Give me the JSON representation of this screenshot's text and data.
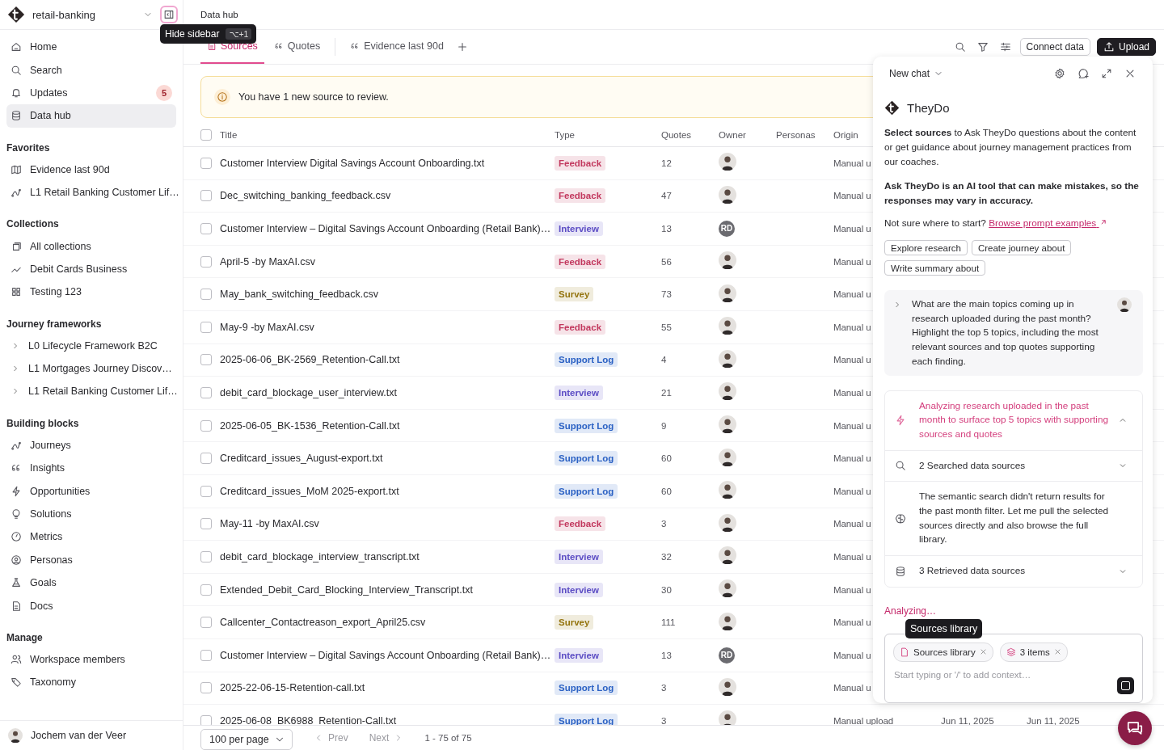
{
  "workspace": {
    "name": "retail-banking",
    "tooltip": {
      "label": "Hide sidebar",
      "shortcut": "⌥+1"
    }
  },
  "nav": [
    {
      "label": "Home",
      "selected": false
    },
    {
      "label": "Search",
      "selected": false
    },
    {
      "label": "Updates",
      "selected": false,
      "badge": "5"
    },
    {
      "label": "Data hub",
      "selected": true
    }
  ],
  "sections": [
    {
      "title": "Favorites",
      "items": [
        {
          "label": "Evidence last 90d"
        },
        {
          "label": "L1 Retail Banking Customer Lif…"
        }
      ]
    },
    {
      "title": "Collections",
      "items": [
        {
          "label": "All collections"
        },
        {
          "label": "Debit Cards Business"
        },
        {
          "label": "Testing 123"
        }
      ]
    },
    {
      "title": "Journey frameworks",
      "items": [
        {
          "label": "L0 Lifecycle Framework B2C",
          "expanded": false
        },
        {
          "label": "L1 Mortgages Journey Discov…",
          "expanded": false
        },
        {
          "label": "L1 Retail Banking Customer Lif…",
          "expanded": false
        }
      ]
    },
    {
      "title": "Building blocks",
      "items": [
        {
          "label": "Journeys"
        },
        {
          "label": "Insights"
        },
        {
          "label": "Opportunities"
        },
        {
          "label": "Solutions"
        },
        {
          "label": "Metrics"
        },
        {
          "label": "Personas"
        },
        {
          "label": "Goals"
        },
        {
          "label": "Docs"
        }
      ]
    },
    {
      "title": "Manage",
      "items": [
        {
          "label": "Workspace members"
        },
        {
          "label": "Taxonomy"
        }
      ]
    }
  ],
  "user": {
    "name": "Jochem van der Veer"
  },
  "breadcrumb": "Data hub",
  "tabs": [
    {
      "label": "Sources",
      "selected": true
    },
    {
      "label": "Quotes",
      "selected": false
    },
    {
      "label": "Evidence last 90d",
      "selected": false
    }
  ],
  "toolbar": {
    "buttons": [
      {
        "label": "Connect data",
        "kind": "secondary"
      },
      {
        "label": "Upload",
        "kind": "primary"
      }
    ]
  },
  "banner": "You have 1 new source to review.",
  "table": {
    "select_all": {
      "checked": false
    },
    "columns": [
      "Title",
      "Type",
      "Quotes",
      "Owner",
      "Personas",
      "Origin"
    ],
    "rows": [
      {
        "checked": false,
        "title": "Customer Interview Digital Savings Account Onboarding.txt",
        "type": {
          "label": "Feedback",
          "color": "#c2385e"
        },
        "quotes": "12",
        "owner": {
          "kind": "avatar"
        },
        "origin": "Manual u"
      },
      {
        "checked": false,
        "title": "Dec_switching_banking_feedback.csv",
        "type": {
          "label": "Feedback",
          "color": "#c2385e"
        },
        "quotes": "47",
        "owner": {
          "kind": "avatar"
        },
        "origin": "Manual u"
      },
      {
        "checked": false,
        "title": "Customer Interview – Digital Savings Account Onboarding (Retail Bank)…",
        "type": {
          "label": "Interview",
          "color": "#5b4cc4"
        },
        "quotes": "13",
        "owner": {
          "kind": "initials",
          "text": "RD"
        },
        "origin": "Manual u"
      },
      {
        "checked": false,
        "title": "April-5 -by MaxAI.csv",
        "type": {
          "label": "Feedback",
          "color": "#c2385e"
        },
        "quotes": "56",
        "owner": {
          "kind": "avatar"
        },
        "origin": "Manual u"
      },
      {
        "checked": false,
        "title": "May_bank_switching_feedback.csv",
        "type": {
          "label": "Survey",
          "color": "#94740f"
        },
        "quotes": "73",
        "owner": {
          "kind": "avatar"
        },
        "origin": "Manual u"
      },
      {
        "checked": false,
        "title": "May-9 -by MaxAI.csv",
        "type": {
          "label": "Feedback",
          "color": "#c2385e"
        },
        "quotes": "55",
        "owner": {
          "kind": "avatar"
        },
        "origin": "Manual u"
      },
      {
        "checked": false,
        "title": "2025-06-06_BK-2569_Retention-Call.txt",
        "type": {
          "label": "Support Log",
          "color": "#2c62c4"
        },
        "quotes": "4",
        "owner": {
          "kind": "avatar"
        },
        "origin": "Manual u"
      },
      {
        "checked": false,
        "title": "debit_card_blockage_user_interview.txt",
        "type": {
          "label": "Interview",
          "color": "#5b4cc4"
        },
        "quotes": "21",
        "owner": {
          "kind": "avatar"
        },
        "origin": "Manual u"
      },
      {
        "checked": false,
        "title": "2025-06-05_BK-1536_Retention-Call.txt",
        "type": {
          "label": "Support Log",
          "color": "#2c62c4"
        },
        "quotes": "9",
        "owner": {
          "kind": "avatar"
        },
        "origin": "Manual u"
      },
      {
        "checked": false,
        "title": "Creditcard_issues_August-export.txt",
        "type": {
          "label": "Support Log",
          "color": "#2c62c4"
        },
        "quotes": "60",
        "owner": {
          "kind": "avatar"
        },
        "origin": "Manual u"
      },
      {
        "checked": false,
        "title": "Creditcard_issues_MoM 2025-export.txt",
        "type": {
          "label": "Support Log",
          "color": "#2c62c4"
        },
        "quotes": "60",
        "owner": {
          "kind": "avatar"
        },
        "origin": "Manual u"
      },
      {
        "checked": false,
        "title": "May-11 -by MaxAI.csv",
        "type": {
          "label": "Feedback",
          "color": "#c2385e"
        },
        "quotes": "3",
        "owner": {
          "kind": "avatar"
        },
        "origin": "Manual u"
      },
      {
        "checked": false,
        "title": "debit_card_blockage_interview_transcript.txt",
        "type": {
          "label": "Interview",
          "color": "#5b4cc4"
        },
        "quotes": "32",
        "owner": {
          "kind": "avatar"
        },
        "origin": "Manual u"
      },
      {
        "checked": false,
        "title": "Extended_Debit_Card_Blocking_Interview_Transcript.txt",
        "type": {
          "label": "Interview",
          "color": "#5b4cc4"
        },
        "quotes": "30",
        "owner": {
          "kind": "avatar"
        },
        "origin": "Manual u"
      },
      {
        "checked": false,
        "title": "Callcenter_Contactreason_export_April25.csv",
        "type": {
          "label": "Survey",
          "color": "#94740f"
        },
        "quotes": "111",
        "owner": {
          "kind": "avatar"
        },
        "origin": "Manual u"
      },
      {
        "checked": false,
        "title": "Customer Interview – Digital Savings Account Onboarding (Retail Bank)…",
        "type": {
          "label": "Interview",
          "color": "#5b4cc4"
        },
        "quotes": "13",
        "owner": {
          "kind": "initials",
          "text": "RD"
        },
        "origin": "Manual u"
      },
      {
        "checked": false,
        "title": "2025-22-06-15-Retention-call.txt",
        "type": {
          "label": "Support Log",
          "color": "#2c62c4"
        },
        "quotes": "3",
        "owner": {
          "kind": "avatar"
        },
        "origin": "Manual u"
      },
      {
        "checked": false,
        "title": "2025-06-08_BK6988_Retention-Call.txt",
        "type": {
          "label": "Support Log",
          "color": "#2c62c4"
        },
        "quotes": "3",
        "owner": {
          "kind": "avatar"
        },
        "origin": "Manual upload",
        "dates": [
          "Jun 11, 2025",
          "Jun 11, 2025"
        ]
      }
    ]
  },
  "pagination": {
    "page_size": "100 per page",
    "prev": {
      "label": "Prev",
      "disabled": true
    },
    "next": {
      "label": "Next",
      "disabled": true
    },
    "range": "1 - 75 of 75"
  },
  "chat": {
    "title": "New chat",
    "brand": "TheyDo",
    "notices": [
      {
        "kind": "plain",
        "text": "**Select sources** to Ask TheyDo questions about the content or get guidance about journey management practices from our coaches."
      },
      {
        "kind": "bold",
        "text": "Ask TheyDo is an AI tool that can make mistakes, so the responses may vary in accuracy."
      }
    ],
    "prompt_hint": {
      "text": "Not sure where to start?",
      "link": "Browse prompt examples"
    },
    "suggestions": [
      "Explore research",
      "Create journey about",
      "Write summary about"
    ],
    "message": {
      "text": "What are the main topics coming up in research uploaded during the past month? Highlight the top 5 topics, including the most relevant sources and top quotes supporting each finding.",
      "expanded": false
    },
    "steps": [
      {
        "kind": "analysis",
        "text": "Analyzing research uploaded in the past month to surface top 5 topics with supporting sources and quotes",
        "expanded": true
      },
      {
        "kind": "search",
        "text": "2 Searched data sources",
        "expanded": false
      },
      {
        "kind": "thought",
        "text": "The semantic search didn't return results for the past month filter. Let me pull the selected sources directly and also browse the full library."
      },
      {
        "kind": "retrieve",
        "text": "3 Retrieved data sources",
        "expanded": false
      }
    ],
    "status": "Analyzing…",
    "composer": {
      "tooltip": "Sources library",
      "chips": [
        {
          "kind": "file",
          "label": "Sources library"
        },
        {
          "kind": "layers",
          "label": "3 items"
        }
      ],
      "placeholder": "Start typing or '/' to add context…"
    }
  }
}
